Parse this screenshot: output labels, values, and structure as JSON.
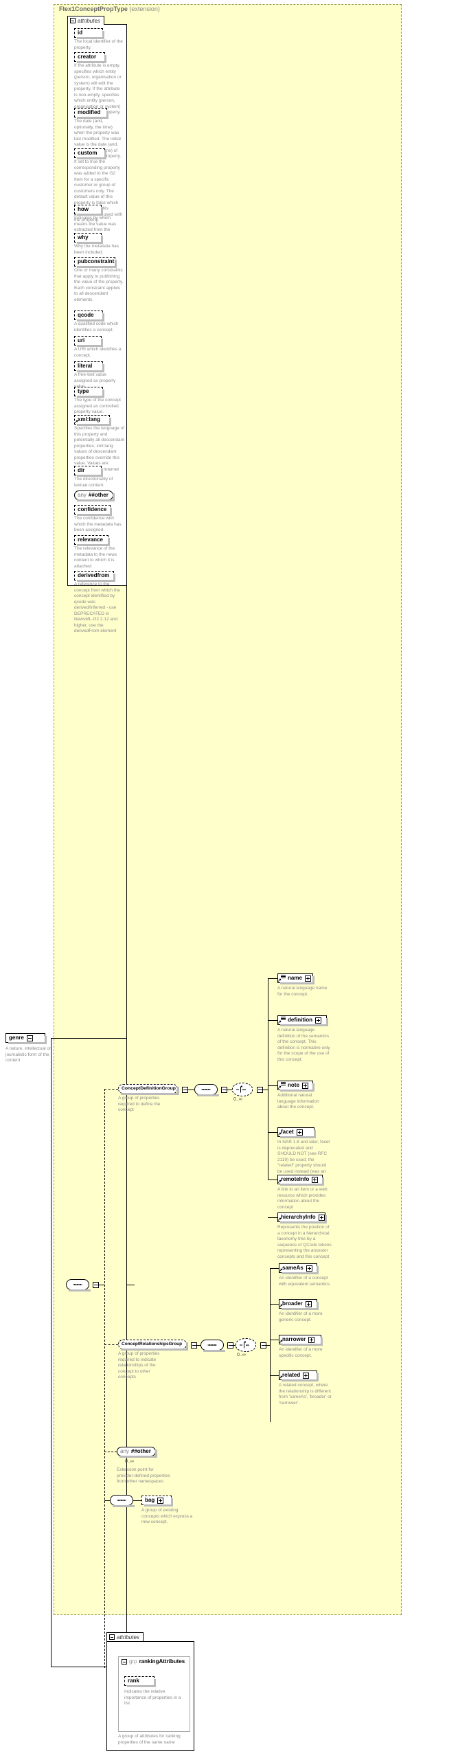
{
  "diagram": {
    "title": "Flex1ConceptPropType",
    "title_suffix": "(extension)",
    "attributes_label": "attributes",
    "group_keyword": "grp",
    "group_name": "rankingAttributes"
  },
  "root": {
    "name": "genre",
    "desc": "A nature, intellectual or journalistic form of the content",
    "toggle": "minus"
  },
  "attributes": [
    {
      "name": "id",
      "desc": "The local identifier of the property."
    },
    {
      "name": "creator",
      "desc": "If the attribute is empty, specifies which entity (person, organisation or system) will edit the property. If the attribute is non-empty, specifies which entity (person, organisation or system) has edited the property."
    },
    {
      "name": "modified",
      "desc": "The date (and, optionally, the time) when the property was last modified. The initial value is the date (and, optionally, the time) of creation of the property."
    },
    {
      "name": "custom",
      "desc": "If set to true the corresponding property was added to the G2 Item for a specific customer or group of customers only. The default value of this property is false which applies when this attribute is not used with the property."
    },
    {
      "name": "how",
      "desc": "Indicates by which means the value was extracted from the content."
    },
    {
      "name": "why",
      "desc": "Why the metadata has been included."
    },
    {
      "name": "pubconstraint",
      "desc": "One or many constraints that apply to publishing the value of the property. Each constraint applies to all descendant elements."
    },
    {
      "name": "qcode",
      "desc": "A qualified code which identifies a concept."
    },
    {
      "name": "uri",
      "desc": "A URI which identifies a concept."
    },
    {
      "name": "literal",
      "desc": "A free-text value assigned as property value."
    },
    {
      "name": "type",
      "desc": "The type of the concept assigned as controlled property value."
    },
    {
      "name": "xml:lang",
      "desc": "Specifies the language of this property and potentially all descendant properties. xml:lang values of descendant properties override this value. Values are determined by Internet BCP 47.",
      "is_ref": true
    },
    {
      "name": "dir",
      "desc": "The directionality of textual content."
    },
    {
      "name": "any_other",
      "label_prefix": "any",
      "label": "##other",
      "desc": "",
      "shape": "rounded"
    },
    {
      "name": "confidence",
      "desc": "The confidence with which the metadata has been assigned."
    },
    {
      "name": "relevance",
      "desc": "The relevance of the metadata to the news content to which it is attached."
    },
    {
      "name": "derivedfrom",
      "desc": "A reference to the concept from which the concept identified by qcode was derived/inferred - use DEPRECATED in NewsML-G2 2.12 and higher, use the derivedFrom element"
    }
  ],
  "groups": {
    "concept_definition": {
      "name": "ConceptDefinitionGroup",
      "desc": "A group of properties required to define the concept",
      "cardinality": "0..∞"
    },
    "concept_relationships": {
      "name": "ConceptRelationshipsGroup",
      "desc": "A group of properties required to indicate relationships of the concept to other concepts",
      "cardinality": "0..∞"
    },
    "any_other": {
      "label_prefix": "any",
      "label": "##other",
      "cardinality": "0..∞",
      "desc": "Extension point for provider-defined properties from other namespaces"
    },
    "bag": {
      "name": "bag",
      "desc": "A group of existing concepts which express a new concept."
    }
  },
  "definition_elements": [
    {
      "name": "name",
      "desc": "A natural language name for the concept."
    },
    {
      "name": "definition",
      "desc": "A natural language definition of the semantics of the concept. This definition is normative only for the scope of the use of this concept."
    },
    {
      "name": "note",
      "desc": "Additional natural language information about the concept."
    },
    {
      "name": "facet",
      "desc": "In NAR 1.8 and later, facet is deprecated and SHOULD NOT (see RFC 2119) be used, the \"related\" property should be used instead (was an intrinsic property of the concept.)"
    },
    {
      "name": "remoteInfo",
      "desc": "A link to an item or a web resource which provides information about the concept"
    },
    {
      "name": "hierarchyInfo",
      "desc": "Represents the position of a concept in a hierarchical taxonomy tree by a sequence of QCode tokens representing the ancestor concepts and this concept"
    }
  ],
  "relationship_elements": [
    {
      "name": "sameAs",
      "desc": "An identifier of a concept with equivalent semantics"
    },
    {
      "name": "broader",
      "desc": "An identifier of a more generic concept."
    },
    {
      "name": "narrower",
      "desc": "An identifier of a more specific concept."
    },
    {
      "name": "related",
      "desc": "A related concept, where the relationship is different from 'sameAs', 'broader' or 'narrower'."
    }
  ],
  "ranking": {
    "attributes_label": "attributes",
    "keyword": "grp",
    "group_name": "rankingAttributes",
    "rank": {
      "name": "rank",
      "desc": "Indicates the relative importance of properties in a list."
    },
    "group_desc": "A group of attributes for ranking properties of the same name"
  },
  "colors": {
    "panel_bg": "#ffffcc",
    "panel_border": "#9a9a55",
    "text": "#333333",
    "desc_text": "#8a8a8a",
    "shadow": "#bbbbbb"
  }
}
